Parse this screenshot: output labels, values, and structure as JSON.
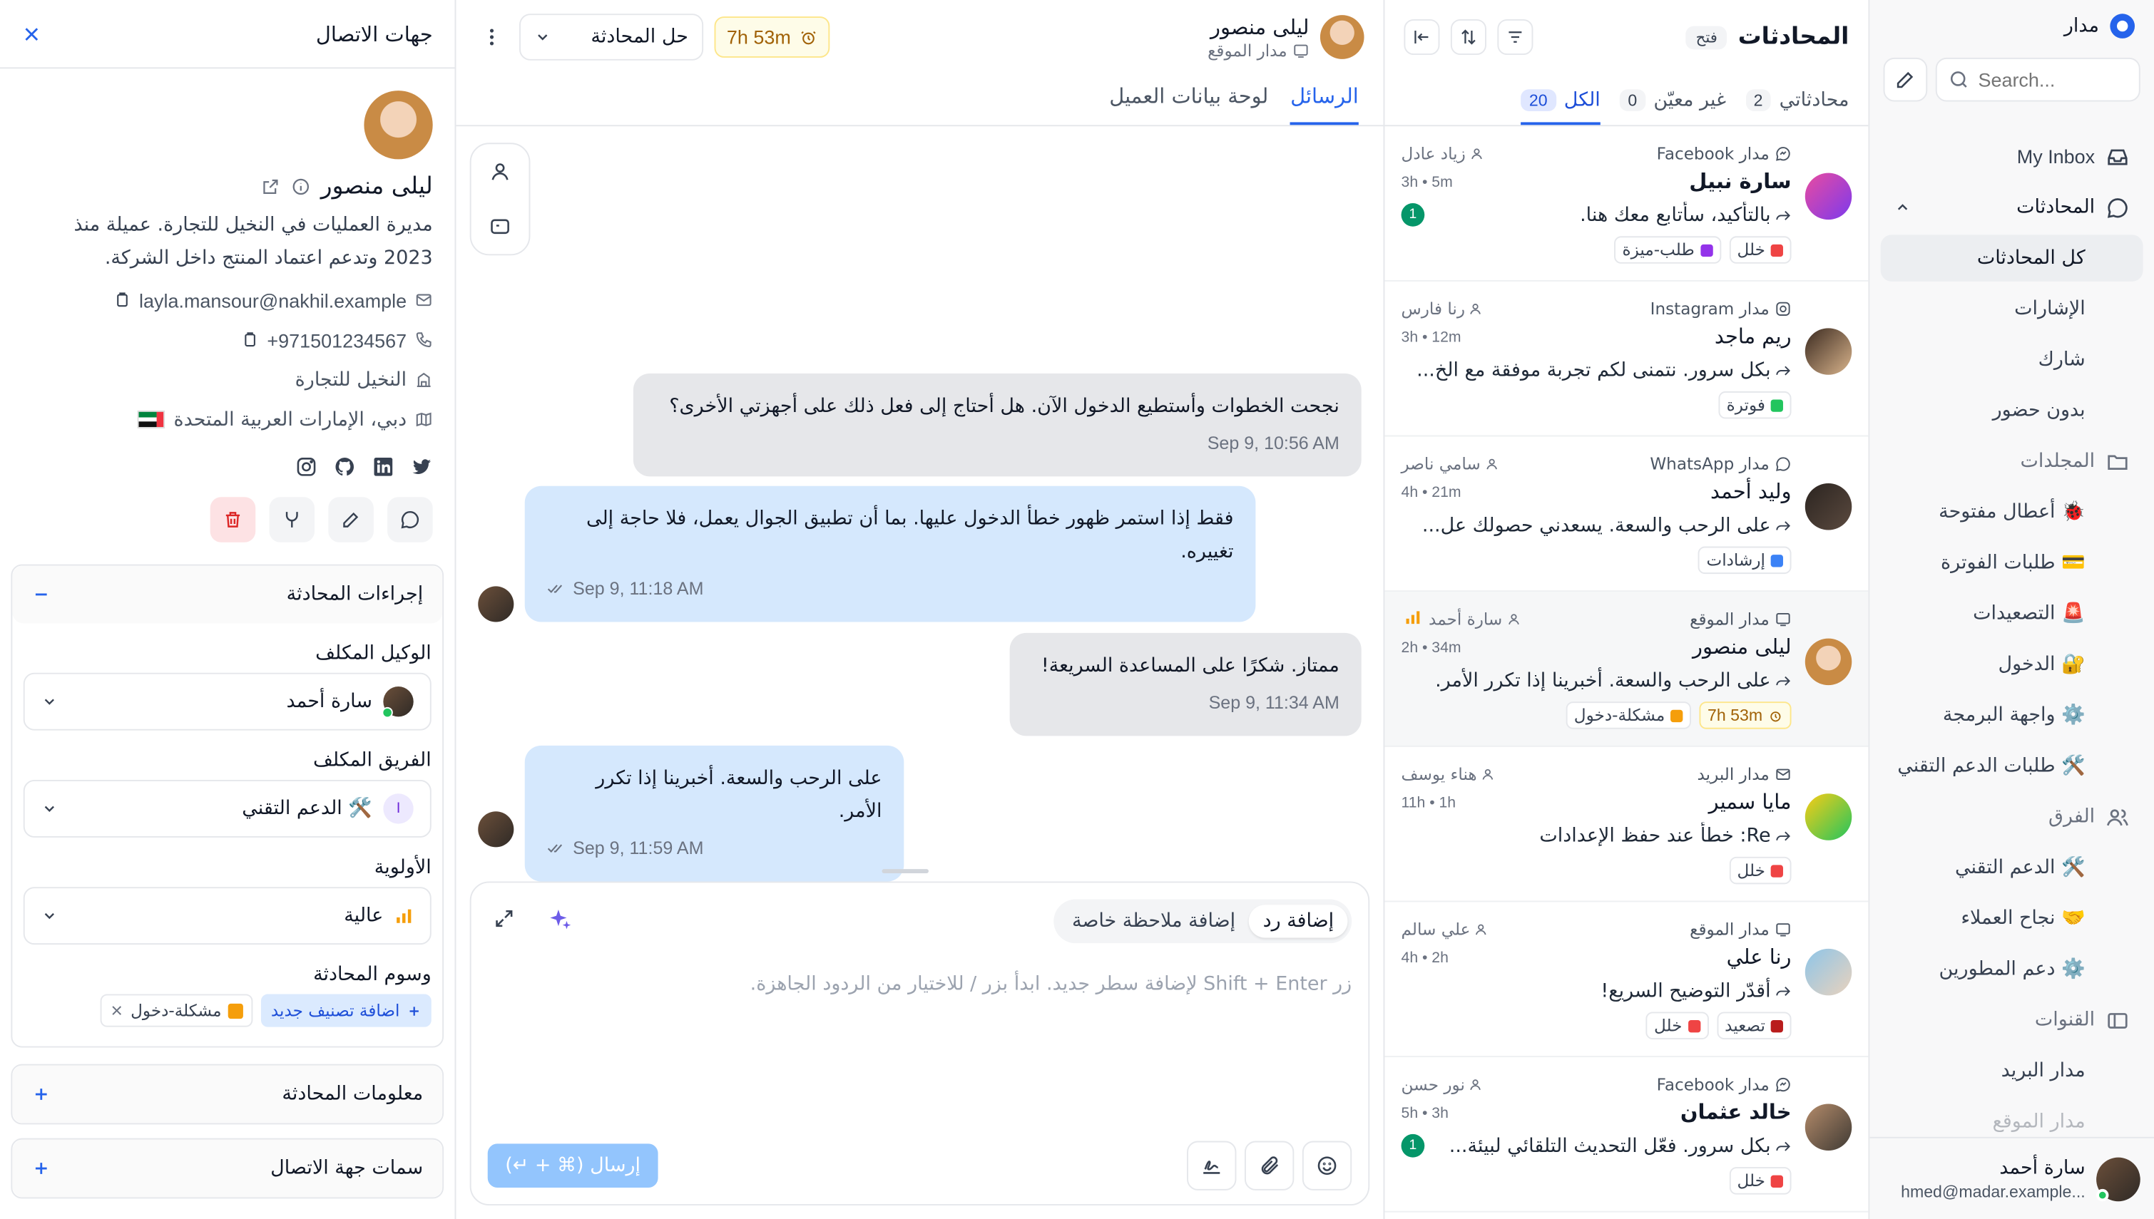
{
  "sidebar": {
    "brand": "مدار",
    "search_placeholder": "Search...",
    "inbox": "My Inbox",
    "conversations": "المحادثات",
    "conv_items": [
      "كل المحادثات",
      "الإشارات",
      "شارك",
      "بدون حضور"
    ],
    "folders": "المجلدات",
    "folder_items": [
      "🐞 أعطال مفتوحة",
      "💳 طلبات الفوترة",
      "🚨 التصعيدات",
      "🔐 الدخول",
      "⚙️ واجهة البرمجة",
      "🛠️ طلبات الدعم التقني"
    ],
    "teams": "الفرق",
    "team_items": [
      "🛠️ الدعم التقني",
      "🤝 نجاح العملاء",
      "⚙️ دعم المطورين"
    ],
    "channels": "القنوات",
    "channel_items": [
      "مدار البريد",
      "مدار الموقع"
    ],
    "user_name": "سارة أحمد",
    "user_email": "...hmed@madar.example"
  },
  "list": {
    "title": "المحادثات",
    "status": "فتح",
    "tabs": [
      {
        "label": "محادثاتي",
        "count": "2"
      },
      {
        "label": "غير معيّن",
        "count": "0"
      },
      {
        "label": "الكل",
        "count": "20"
      }
    ],
    "conversations": [
      {
        "channel": "مدار Facebook",
        "agent": "زياد عادل",
        "name": "سارة نبيل",
        "time": "3h • 5m",
        "preview": "بالتأكيد، سأتابع معك هنا.",
        "tags": [
          {
            "text": "خلل",
            "color": "#ef4444"
          },
          {
            "text": "طلب-ميزة",
            "color": "#9333ea"
          }
        ],
        "unread": "1",
        "bold": true
      },
      {
        "channel": "مدار Instagram",
        "agent": "رنا فارس",
        "name": "ريم ماجد",
        "time": "3h • 12m",
        "preview": "بكل سرور. نتمنى لكم تجربة موفقة مع الخ...",
        "tags": [
          {
            "text": "فوترة",
            "color": "#22c55e"
          }
        ]
      },
      {
        "channel": "مدار WhatsApp",
        "agent": "سامي ناصر",
        "name": "وليد أحمد",
        "time": "4h • 21m",
        "preview": "على الرحب والسعة. يسعدني حصولك عل...",
        "tags": [
          {
            "text": "إرشادات",
            "color": "#3b82f6"
          }
        ]
      },
      {
        "channel": "مدار الموقع",
        "agent": "سارة أحمد",
        "name": "ليلى منصور",
        "time": "2h • 34m",
        "preview": "على الرحب والسعة. أخبرينا إذا تكرر الأمر.",
        "tags": [
          {
            "text": "7h 53m",
            "color": "#a16207",
            "timer": true
          },
          {
            "text": "مشكلة-دخول",
            "color": "#f59e0b"
          }
        ],
        "selected": true,
        "priority": true
      },
      {
        "channel": "مدار البريد",
        "agent": "هناء يوسف",
        "name": "مايا سمير",
        "time": "11h • 1h",
        "preview": "Re: خطأ عند حفظ الإعدادات",
        "tags": [
          {
            "text": "خلل",
            "color": "#ef4444"
          }
        ]
      },
      {
        "channel": "مدار الموقع",
        "agent": "علي سالم",
        "name": "رنا علي",
        "time": "4h • 2h",
        "preview": "أقدّر التوضيح السريع!",
        "tags": [
          {
            "text": "تصعيد",
            "color": "#b91c1c"
          },
          {
            "text": "خلل",
            "color": "#ef4444"
          }
        ]
      },
      {
        "channel": "مدار Facebook",
        "agent": "نور حسن",
        "name": "خالد عثمان",
        "time": "5h • 3h",
        "preview": "بكل سرور. فعّل التحديث التلقائي لبيئة...",
        "tags": [
          {
            "text": "خلل",
            "color": "#ef4444"
          }
        ],
        "unread": "1",
        "bold": true
      }
    ]
  },
  "chat": {
    "name": "ليلى منصور",
    "channel": "مدار الموقع",
    "timer": "7h 53m",
    "resolve": "حل المحادثة",
    "tabs": [
      "الرسائل",
      "لوحة بيانات العميل"
    ],
    "messages": [
      {
        "text": "نجحت الخطوات وأستطيع الدخول الآن. هل أحتاج إلى فعل ذلك على أجهزتي الأخرى؟",
        "time": "Sep 9, 10:56 AM"
      },
      {
        "text": "فقط إذا استمر ظهور خطأ الدخول عليها. بما أن تطبيق الجوال يعمل، فلا حاجة إلى تغييره.",
        "time": "Sep 9, 11:18 AM"
      },
      {
        "text": "ممتاز. شكرًا على المساعدة السريعة!",
        "time": "Sep 9, 11:34 AM"
      },
      {
        "text": "على الرحب والسعة. أخبرينا إذا تكرر الأمر.",
        "time": "Sep 9, 11:59 AM"
      }
    ],
    "mode_reply": "إضافة رد",
    "mode_note": "إضافة ملاحظة خاصة",
    "placeholder": "زر Shift + Enter لإضافة سطر جديد. ابدأ بزر / للاختيار من الردود الجاهزة.",
    "send": "إرسال (⌘ + ↵)"
  },
  "contact": {
    "title": "جهات الاتصال",
    "name": "ليلى منصور",
    "bio": "مديرة العمليات في النخيل للتجارة. عميلة منذ 2023 وتدعم اعتماد المنتج داخل الشركة.",
    "email": "layla.mansour@nakhil.example",
    "phone": "+971501234567",
    "company": "النخيل للتجارة",
    "location": "دبي، الإمارات العربية المتحدة",
    "actions_title": "إجراءات المحادثة",
    "assignee_label": "الوكيل المكلف",
    "assignee": "سارة أحمد",
    "team_label": "الفريق المكلف",
    "team": "🛠️ الدعم التقني",
    "team_initial": "I",
    "priority_label": "الأولوية",
    "priority": "عالية",
    "labels_title": "وسوم المحادثة",
    "add_label": "اضافة تصنيف جديد",
    "label": "مشكلة-دخول",
    "info_title": "معلومات المحادثة",
    "attrs_title": "سمات جهة الاتصال"
  },
  "colors": {
    "accent": "#2563eb",
    "bubble_out": "#d5e8fd",
    "bubble_in": "#e6e7ea",
    "timer": "#a16207"
  }
}
